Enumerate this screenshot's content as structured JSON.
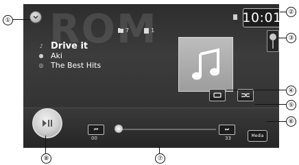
{
  "watermark": "ROM",
  "clock": "10:01",
  "counts": {
    "folders": "7",
    "files": "1"
  },
  "track": {
    "title": "Drive it",
    "artist": "Aki",
    "album": "The Best Hits"
  },
  "playback": {
    "elapsed": "00",
    "remaining": "33",
    "media_label": "Media"
  },
  "callouts": [
    "①",
    "②",
    "③",
    "④",
    "⑤",
    "⑥",
    "⑦",
    "⑧"
  ],
  "icons": {
    "list_chevron": "chevron-down-icon",
    "pin": "pin-icon",
    "repeat": "repeat-icon",
    "shuffle": "shuffle-icon",
    "play_pause": "play-pause-icon",
    "prev": "previous-track-icon",
    "next": "next-track-icon",
    "artwork": "music-note-icon"
  },
  "colors": {
    "panel": "#333333",
    "text": "#ffffff",
    "accent": "#d0d0d0"
  }
}
